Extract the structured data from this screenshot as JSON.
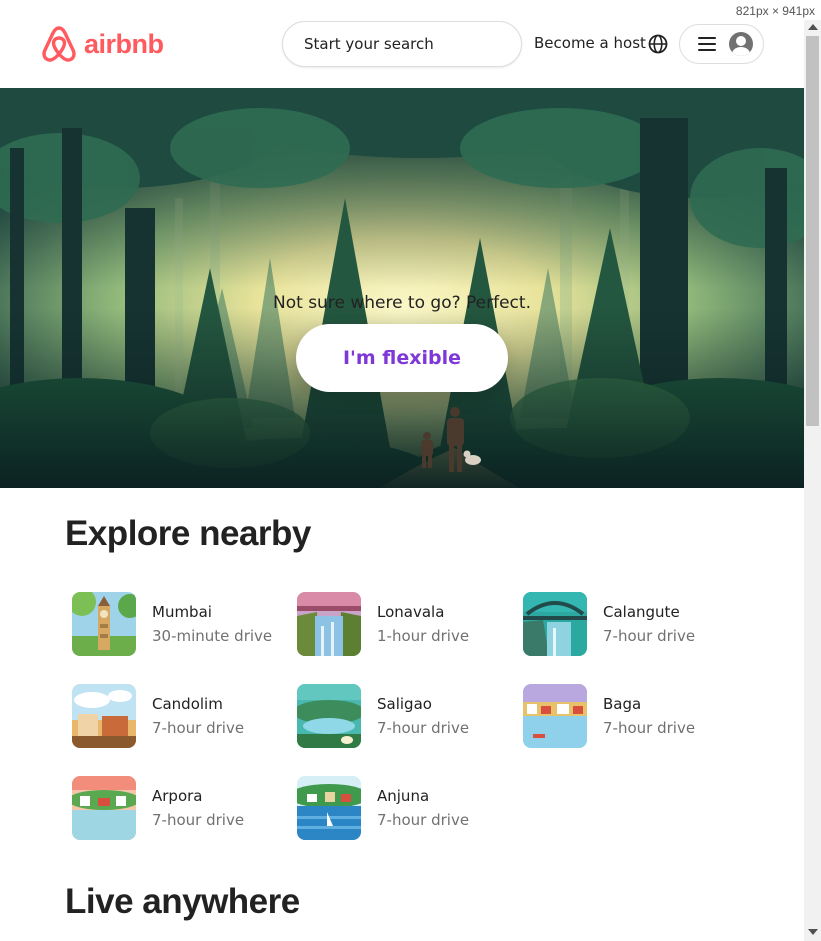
{
  "viewport_label": "821px × 941px",
  "header": {
    "brand": "airbnb",
    "search_label": "Start your search",
    "become_host": "Become a host"
  },
  "hero": {
    "tagline": "Not sure where to go? Perfect.",
    "cta": "I'm flexible"
  },
  "explore": {
    "title": "Explore nearby",
    "items": [
      {
        "name": "Mumbai",
        "drive": "30-minute drive"
      },
      {
        "name": "Lonavala",
        "drive": "1-hour drive"
      },
      {
        "name": "Calangute",
        "drive": "7-hour drive"
      },
      {
        "name": "Candolim",
        "drive": "7-hour drive"
      },
      {
        "name": "Saligao",
        "drive": "7-hour drive"
      },
      {
        "name": "Baga",
        "drive": "7-hour drive"
      },
      {
        "name": "Arpora",
        "drive": "7-hour drive"
      },
      {
        "name": "Anjuna",
        "drive": "7-hour drive"
      }
    ]
  },
  "live": {
    "title": "Live anywhere"
  },
  "colors": {
    "brand": "#ff5a5f",
    "cta_text": "#7e38d8",
    "secondary_text": "#717171"
  }
}
